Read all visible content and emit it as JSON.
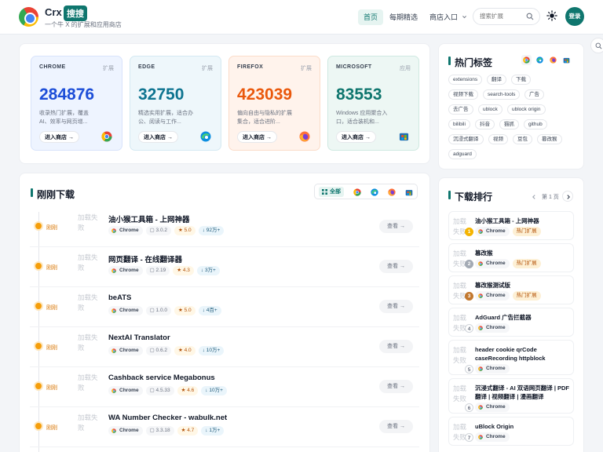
{
  "header": {
    "brand": "Crx",
    "brand_badge": "搜搜",
    "tagline": "一个牛 X 的扩展和应用商店",
    "nav": [
      {
        "label": "首页",
        "active": true
      },
      {
        "label": "每期精选",
        "active": false
      },
      {
        "label": "商店入口",
        "active": false
      }
    ],
    "search_placeholder": "搜索扩展",
    "login_label": "登录"
  },
  "stores": [
    {
      "name": "CHROME",
      "type": "扩展",
      "count": "284876",
      "desc": "收录热门扩展，覆盖 AI、效率与网页增...",
      "button": "进入商店",
      "color": "#1d4ed8",
      "icon": "chrome-icon"
    },
    {
      "name": "EDGE",
      "type": "扩展",
      "count": "32750",
      "desc": "精选实用扩展，适合办公、阅读与工作...",
      "button": "进入商店",
      "color": "#0e7490",
      "icon": "edge-icon"
    },
    {
      "name": "FIREFOX",
      "type": "扩展",
      "count": "423039",
      "desc": "偏向自由与隐私的扩展集合，适合进阶...",
      "button": "进入商店",
      "color": "#ea580c",
      "icon": "firefox-icon"
    },
    {
      "name": "MICROSOFT",
      "type": "应用",
      "count": "83553",
      "desc": "Windows 应用聚合入口，适合装机和...",
      "button": "进入商店",
      "color": "#0f766e",
      "icon": "microsoft-store-icon"
    }
  ],
  "recent": {
    "title": "刚刚下载",
    "filter_all": "全部",
    "items": [
      {
        "badge": "刚刚",
        "thumb": "加载失败",
        "title": "油小猴工具箱 - 上网神器",
        "browser": "Chrome",
        "version": "3.0.2",
        "rating": "5.0",
        "downloads": "92万+",
        "view": "查看"
      },
      {
        "badge": "刚刚",
        "thumb": "加载失败",
        "title": "网页翻译 - 在线翻译器",
        "browser": "Chrome",
        "version": "2.19",
        "rating": "4.3",
        "downloads": "3万+",
        "view": "查看"
      },
      {
        "badge": "刚刚",
        "thumb": "加载失败",
        "title": "beATS",
        "browser": "Chrome",
        "version": "1.0.0",
        "rating": "5.0",
        "downloads": "4百+",
        "view": "查看"
      },
      {
        "badge": "刚刚",
        "thumb": "加载失败",
        "title": "NextAI Translator",
        "browser": "Chrome",
        "version": "0.6.2",
        "rating": "4.0",
        "downloads": "10万+",
        "view": "查看"
      },
      {
        "badge": "刚刚",
        "thumb": "加载失败",
        "title": "Cashback service Megabonus",
        "browser": "Chrome",
        "version": "4.5.33",
        "rating": "4.6",
        "downloads": "10万+",
        "view": "查看"
      },
      {
        "badge": "刚刚",
        "thumb": "加载失败",
        "title": "WA Number Checker - wabulk.net",
        "browser": "Chrome",
        "version": "3.3.18",
        "rating": "4.7",
        "downloads": "1万+",
        "view": "查看"
      }
    ]
  },
  "hot_tags": {
    "title": "热门标签",
    "tags": [
      "extensions",
      "翻译",
      "下载",
      "视频下载",
      "search-tools",
      "广告",
      "去广告",
      "ublock",
      "ublock origin",
      "bilibili",
      "抖音",
      "猫抓",
      "github",
      "沉浸式翻译",
      "视频",
      "豆包",
      "篡改猴",
      "adguard"
    ]
  },
  "ranking": {
    "title": "下载排行",
    "page": "第 1 页",
    "items": [
      {
        "rank": "1",
        "thumb": "加载失败",
        "title": "油小猴工具箱 - 上网神器",
        "browser": "Chrome",
        "hot": "热门扩展"
      },
      {
        "rank": "2",
        "thumb": "加载失败",
        "title": "篡改猴",
        "browser": "Chrome",
        "hot": "热门扩展"
      },
      {
        "rank": "3",
        "thumb": "加载失败",
        "title": "篡改猴测试版",
        "browser": "Chrome",
        "hot": "热门扩展"
      },
      {
        "rank": "4",
        "thumb": "加载失败",
        "title": "AdGuard 广告拦截器",
        "browser": "Chrome",
        "hot": ""
      },
      {
        "rank": "5",
        "thumb": "加载失败",
        "title": "header cookie qrCode caseRecording httpblock",
        "browser": "Chrome",
        "hot": ""
      },
      {
        "rank": "6",
        "thumb": "加载失败",
        "title": "沉浸式翻译 - AI 双语网页翻译 | PDF翻译 | 视频翻译 | 漫画翻译",
        "browser": "Chrome",
        "hot": ""
      },
      {
        "rank": "7",
        "thumb": "加载失败",
        "title": "uBlock Origin",
        "browser": "Chrome",
        "hot": ""
      }
    ]
  }
}
